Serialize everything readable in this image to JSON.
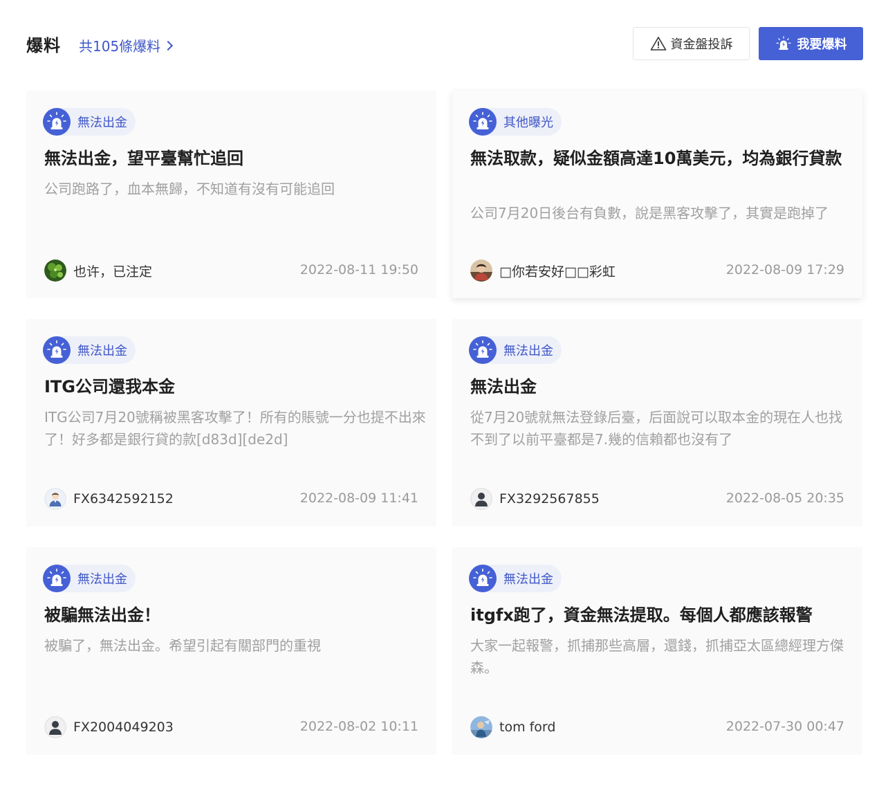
{
  "header": {
    "title": "爆料",
    "count_link": "共105條爆料",
    "complaint_button": "資金盤投訴",
    "report_button": "我要爆料"
  },
  "colors": {
    "accent": "#4661d6",
    "tag_bg": "#eef0f9",
    "card_bg": "#fafafa",
    "muted_text": "#a0a0a0"
  },
  "cards": [
    {
      "tag": "無法出金",
      "title": "無法出金，望平臺幫忙追回",
      "desc": "公司跑路了，血本無歸，不知道有沒有可能追回",
      "author": "也许，已注定",
      "avatar": "green-leaf-avatar",
      "date": "2022-08-11 19:50"
    },
    {
      "tag": "其他曝光",
      "title": "無法取款，疑似金額高達10萬美元，均為銀行貸款",
      "desc": "公司7月20日後台有負數，說是黑客攻擊了，其實是跑掉了",
      "author": "□你若安好□□彩虹",
      "avatar": "photo-avatar",
      "date": "2022-08-09 17:29"
    },
    {
      "tag": "無法出金",
      "title": "ITG公司還我本金",
      "desc": "ITG公司7月20號稱被黑客攻擊了！所有的賬號一分也提不出來了！好多都是銀行貸的款[d83d][de2d]",
      "author": "FX6342592152",
      "avatar": "default-user-avatar-light",
      "date": "2022-08-09 11:41"
    },
    {
      "tag": "無法出金",
      "title": "無法出金",
      "desc": "從7月20號就無法登錄后臺，后面說可以取本金的現在人也找不到了以前平臺都是7.幾的信賴都也沒有了",
      "author": "FX3292567855",
      "avatar": "default-user-avatar-dark",
      "date": "2022-08-05 20:35"
    },
    {
      "tag": "無法出金",
      "title": "被騙無法出金！",
      "desc": "被騙了，無法出金。希望引起有關部門的重視",
      "author": "FX2004049203",
      "avatar": "default-user-avatar-dark",
      "date": "2022-08-02 10:11"
    },
    {
      "tag": "無法出金",
      "title": "itgfx跑了，資金無法提取。每個人都應該報警",
      "desc": "大家一起報警，抓捕那些高層，還錢，抓捕亞太區總經理方傑森。",
      "author": "tom ford",
      "avatar": "photo-avatar-blue",
      "date": "2022-07-30 00:47"
    }
  ]
}
